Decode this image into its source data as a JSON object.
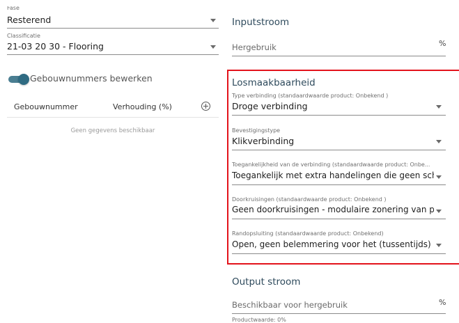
{
  "left": {
    "fase": {
      "label": "Fase",
      "value": "Resterend"
    },
    "classificatie": {
      "label": "Classificatie",
      "value": "21-03 20 30 - Flooring"
    },
    "toggle_label": "Gebouwnummers bewerken",
    "table": {
      "headers": [
        "Gebouwnummer",
        "Verhouding (%)"
      ],
      "empty": "Geen gegevens beschikbaar"
    }
  },
  "right": {
    "inputstroom": {
      "title": "Inputstroom",
      "hergebruik_label": "Hergebruik",
      "unit": "%"
    },
    "losmaakbaarheid": {
      "title": "Losmaakbaarheid",
      "fields": [
        {
          "label": "Type verbinding (standaardwaarde product: Onbekend )",
          "value": "Droge verbinding"
        },
        {
          "label": "Bevestigingstype",
          "value": "Klikverbinding"
        },
        {
          "label": "Toegankelijkheid van de verbinding (standaardwaarde product: Onbe...",
          "value": "Toegankelijk met extra handelingen die geen scha"
        },
        {
          "label": "Doorkruisingen (standaardwaarde product: Onbekend )",
          "value": "Geen doorkruisingen - modulaire zonering van pro"
        },
        {
          "label": "Randopsluiting (standaardwaarde product: Onbekend)",
          "value": "Open, geen belemmering voor het (tussentijds) uit"
        }
      ]
    },
    "outputstroom": {
      "title": "Output stroom",
      "beschikbaar_label": "Beschikbaar voor hergebruik",
      "unit": "%",
      "productwaarde": "Productwaarde: 0%"
    }
  },
  "colors": {
    "highlight": "#e3121b",
    "toggle": "#2f6b82",
    "heading": "#2e4a5c"
  }
}
